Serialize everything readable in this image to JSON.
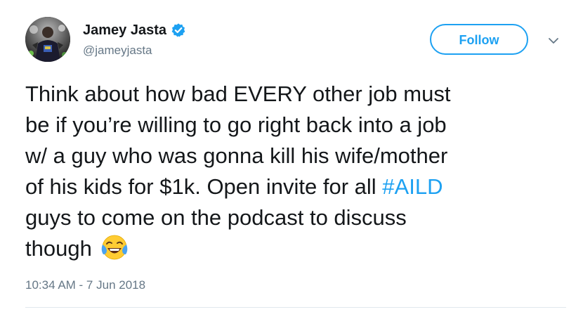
{
  "colors": {
    "accent": "#1da1f2",
    "text": "#14171a",
    "secondary": "#657786",
    "divider": "#e1e8ed"
  },
  "author": {
    "display_name": "Jamey Jasta",
    "handle": "@jameyjasta",
    "verified_icon": "verified-badge-icon",
    "avatar": "profile-photo"
  },
  "actions": {
    "follow_label": "Follow",
    "more_icon": "chevron-down-icon"
  },
  "tweet": {
    "lines": [
      "Think about how bad EVERY other job must",
      "be if you’re willing to go right back into a job",
      "w/ a guy who was gonna kill his wife/mother",
      "of his kids for $1k. Open invite for all "
    ],
    "hashtag": "#AILD",
    "line5": "guys to come on the podcast to discuss",
    "line6": "though",
    "emoji": "face-with-tears-of-joy-icon"
  },
  "timestamp": "10:34 AM - 7 Jun 2018"
}
